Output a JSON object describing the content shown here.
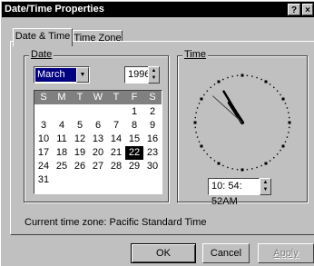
{
  "window": {
    "title": "Date/Time Properties",
    "help_glyph": "?",
    "close_glyph": "×"
  },
  "tabs": [
    {
      "label": "Date & Time",
      "active": true
    },
    {
      "label": "Time Zone",
      "active": false
    }
  ],
  "date_group": {
    "label": "Date",
    "month": "March",
    "year": "1996",
    "weekdays": [
      "S",
      "M",
      "T",
      "W",
      "T",
      "F",
      "S"
    ],
    "first_weekday_index": 5,
    "days_in_month": 31,
    "selected_day": 22
  },
  "time_group": {
    "label": "Time",
    "time_text": "10: 54: 52AM",
    "clock": {
      "hour": 10,
      "minute": 54,
      "second": 52
    }
  },
  "timezone_text": "Current time zone:  Pacific Standard Time",
  "buttons": {
    "ok": "OK",
    "cancel": "Cancel",
    "apply": "Apply"
  },
  "colors": {
    "selection": "#000080",
    "calendar_header": "#808080",
    "face": "#c0c0c0"
  }
}
